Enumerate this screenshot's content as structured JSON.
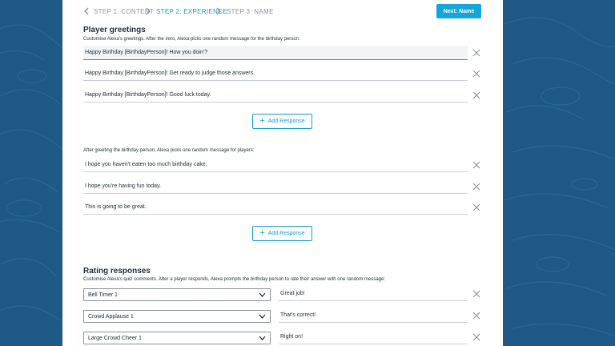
{
  "stepper": {
    "steps": [
      {
        "label": "STEP 1: CONTENT"
      },
      {
        "label": "STEP 2: EXPERIENCE"
      },
      {
        "label": "STEP 3: NAME"
      }
    ],
    "next_label": "Next: Name"
  },
  "player_greetings": {
    "title": "Player greetings",
    "birthday_desc": "Customise Alexa's greetings. After the intro, Alexa picks one random message for the birthday person:",
    "birthday_messages": [
      "Happy Birthday [BirthdayPerson]! How you doin'?",
      "Happy Birthday [BirthdayPerson]! Get ready to judge those answers.",
      "Happy Birthday [BirthdayPerson]! Good luck today."
    ],
    "add_label": "Add Response",
    "players_desc": "After greeting the birthday person, Alexa picks one random message for players:",
    "player_messages": [
      "I hope you haven't eaten too much birthday cake.",
      "I hope you're having fun today.",
      "This is going to be great."
    ]
  },
  "rating_responses": {
    "title": "Rating responses",
    "desc": "Customise Alexa's quiz comments. After a player responds, Alexa prompts the birthday person to rate their answer with one random message:",
    "rows": [
      {
        "sound": "Bell Timer 1",
        "comment": "Great job!"
      },
      {
        "sound": "Crowd Applause 1",
        "comment": "That's correct!"
      },
      {
        "sound": "Large Crowd Cheer 1",
        "comment": "Right on!"
      }
    ]
  },
  "colors": {
    "background": "#1f5a86",
    "accent": "#1a98d5",
    "text": "#232f3e"
  }
}
